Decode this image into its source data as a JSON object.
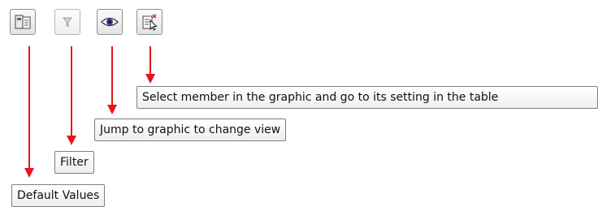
{
  "toolbar": {
    "buttons": [
      {
        "name": "default-values",
        "icon": "default-values-icon"
      },
      {
        "name": "filter",
        "icon": "filter-icon",
        "disabled": true
      },
      {
        "name": "jump-to-graphic",
        "icon": "eye-icon"
      },
      {
        "name": "select-member",
        "icon": "select-member-icon"
      }
    ]
  },
  "callouts": {
    "select_member": "Select member in the graphic and go to its setting in the table",
    "jump_to_graphic": "Jump to graphic to change view",
    "filter": "Filter",
    "default_values": "Default Values"
  },
  "colors": {
    "arrow": "#e8141b",
    "button_border": "#8e8f8f",
    "eye_iris": "#3a3aa0"
  }
}
